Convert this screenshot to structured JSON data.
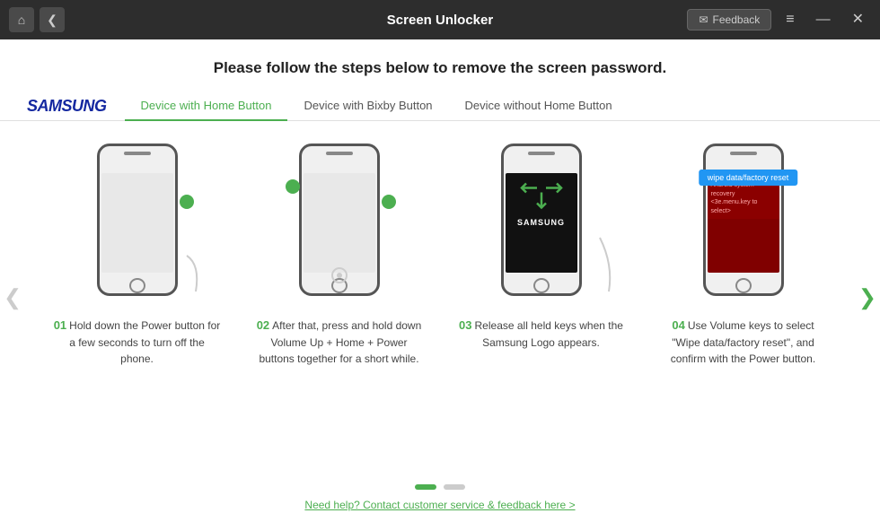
{
  "titleBar": {
    "title": "Screen Unlocker",
    "homeIcon": "⌂",
    "backIcon": "❮",
    "feedbackIcon": "✉",
    "feedbackLabel": "Feedback",
    "menuIcon": "≡",
    "minimizeIcon": "—",
    "closeIcon": "✕"
  },
  "heading": "Please follow the steps below to remove the screen password.",
  "tabs": {
    "brand": "SAMSUNG",
    "items": [
      {
        "id": "home-button",
        "label": "Device with Home Button",
        "active": true
      },
      {
        "id": "bixby-button",
        "label": "Device with Bixby Button",
        "active": false
      },
      {
        "id": "no-home-button",
        "label": "Device without Home Button",
        "active": false
      }
    ]
  },
  "steps": [
    {
      "num": "01",
      "text": "Hold down the Power button for a few seconds to turn off the phone."
    },
    {
      "num": "02",
      "text": "After that, press and hold down Volume Up + Home + Power buttons together for a short while."
    },
    {
      "num": "03",
      "text": "Release all held keys when the Samsung Logo appears."
    },
    {
      "num": "04",
      "text": "Use Volume keys to select \"Wipe data/factory reset\", and confirm with the Power button."
    }
  ],
  "wipeLabel": "wipe data/factory reset",
  "pagination": {
    "dots": [
      {
        "active": true
      },
      {
        "active": false
      }
    ]
  },
  "footer": {
    "linkText": "Need help? Contact customer service & feedback here >"
  }
}
